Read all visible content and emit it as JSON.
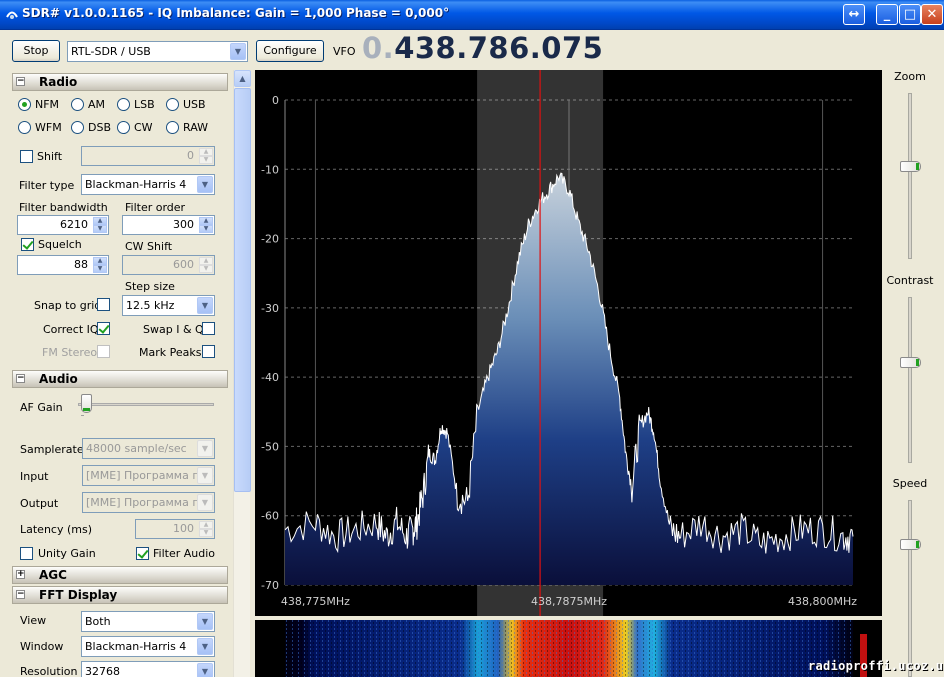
{
  "window": {
    "title": "SDR# v1.0.0.1165 - IQ Imbalance: Gain = 1,000 Phase = 0,000°",
    "colors": {
      "titlebar": "#0058e6",
      "face": "#ece9d8"
    }
  },
  "toolbar": {
    "stop_label": "Stop",
    "device": "RTL-SDR / USB",
    "configure_label": "Configure",
    "vfo_label": "VFO",
    "vfo_prefix": "0.",
    "vfo_value": "438.786.075"
  },
  "radio": {
    "header": "Radio",
    "modes": [
      "NFM",
      "AM",
      "LSB",
      "USB",
      "WFM",
      "DSB",
      "CW",
      "RAW"
    ],
    "selected_mode": "NFM",
    "shift_label": "Shift",
    "shift_value": "0",
    "filter_type_label": "Filter type",
    "filter_type": "Blackman-Harris 4",
    "filter_bandwidth_label": "Filter bandwidth",
    "filter_bandwidth": "6210",
    "filter_order_label": "Filter order",
    "filter_order": "300",
    "squelch_label": "Squelch",
    "squelch_value": "88",
    "cw_shift_label": "CW Shift",
    "cw_shift_value": "600",
    "step_size_label": "Step size",
    "step_size": "12.5 kHz",
    "snap_label": "Snap to grid",
    "swap_label": "Swap I & Q",
    "correct_iq_label": "Correct IQ",
    "fm_stereo_label": "FM Stereo",
    "mark_peaks_label": "Mark Peaks"
  },
  "audio": {
    "header": "Audio",
    "af_gain_label": "AF Gain",
    "af_gain": 0.02,
    "samplerate_label": "Samplerate",
    "samplerate": "48000 sample/sec",
    "input_label": "Input",
    "input": "[MME] Программа переназначения звук. устр. - Input",
    "output_label": "Output",
    "output": "[MME] Программа переназначения звук. устр. - Output",
    "latency_label": "Latency (ms)",
    "latency": "100",
    "unity_gain_label": "Unity Gain",
    "filter_audio_label": "Filter Audio"
  },
  "agc": {
    "header": "AGC"
  },
  "fft": {
    "header": "FFT Display",
    "view_label": "View",
    "view": "Both",
    "window_label": "Window",
    "window": "Blackman-Harris 4",
    "resolution_label": "Resolution",
    "resolution": "32768"
  },
  "sliders": {
    "zoom_label": "Zoom",
    "zoom": 0.55,
    "contrast_label": "Contrast",
    "contrast": 0.6,
    "speed_label": "Speed",
    "speed": 0.75
  },
  "watermark": "radioproffi.ucoz.ua",
  "chart_data": {
    "type": "area",
    "xlabel": "",
    "ylabel": "",
    "y_ticks": [
      "0",
      "-10",
      "-20",
      "-30",
      "-40",
      "-50",
      "-60",
      "-70"
    ],
    "ylim": [
      -70,
      0
    ],
    "x_tick_labels": [
      "438,775MHz",
      "438,7875MHz",
      "438,800MHz"
    ],
    "x_ticks_mhz": [
      438.775,
      438.7875,
      438.8
    ],
    "xlim_mhz": [
      438.7735,
      438.8015
    ],
    "grid": true,
    "vfo_mhz": 438.786075,
    "filter_passband_mhz": [
      438.78297,
      438.78918
    ],
    "series": [
      {
        "x_mhz": [
          438.7735,
          438.775,
          438.776,
          438.777,
          438.778,
          438.7785,
          438.779,
          438.7795,
          438.7798,
          438.78,
          438.7803,
          438.7806,
          438.7809,
          438.7812,
          438.7815,
          438.782,
          438.7825,
          438.783,
          438.7835,
          438.784,
          438.7845,
          438.785,
          438.7855,
          438.786,
          438.7865,
          438.787,
          438.7875,
          438.788,
          438.7885,
          438.789,
          438.7895,
          438.79,
          438.7903,
          438.7906,
          438.791,
          438.7914,
          438.7917,
          438.792,
          438.7925,
          438.793,
          438.794,
          438.795,
          438.796,
          438.797,
          438.798,
          438.799,
          438.8,
          438.801,
          438.8015
        ],
        "y_db": [
          -62,
          -61,
          -63,
          -62,
          -61,
          -63,
          -61,
          -63,
          -62,
          -61,
          -57,
          -51,
          -52,
          -47,
          -48,
          -57,
          -58,
          -45,
          -40,
          -36,
          -30,
          -23,
          -18,
          -15,
          -13,
          -11,
          -13,
          -18,
          -22,
          -28,
          -36,
          -43,
          -51,
          -56,
          -47,
          -45,
          -48,
          -55,
          -62,
          -63,
          -61,
          -63,
          -62,
          -64,
          -63,
          -62,
          -62,
          -63,
          -63
        ]
      }
    ]
  }
}
